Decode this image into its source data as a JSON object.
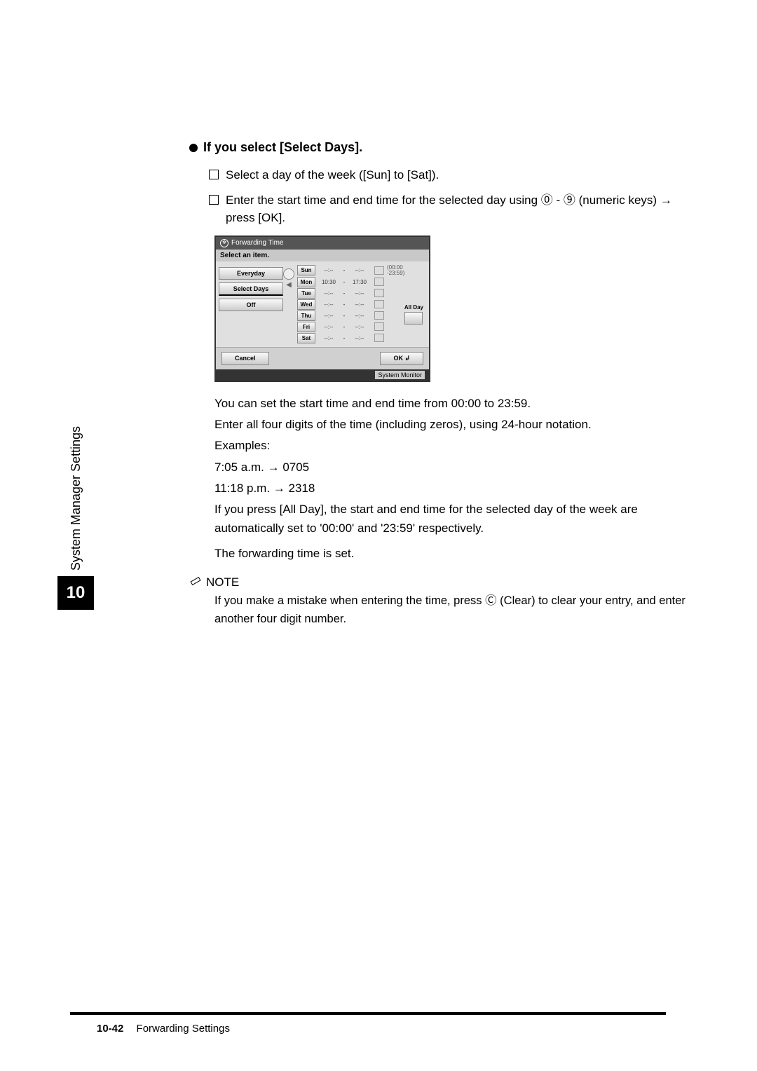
{
  "side": {
    "label": "System Manager Settings",
    "chapter": "10"
  },
  "heading": "If you select [Select Days].",
  "sub": [
    "Select a day of the week ([Sun] to [Sat]).",
    "Enter the start time and end time for the selected day using ⓪ - ⑨ (numeric keys) → press [OK]."
  ],
  "screenshot": {
    "title": "Forwarding Time",
    "subtitle": "Select an item.",
    "leftButtons": [
      "Everyday",
      "Select Days",
      "Off"
    ],
    "days": [
      "Sun",
      "Mon",
      "Tue",
      "Wed",
      "Thu",
      "Fri",
      "Sat"
    ],
    "empty": "--:--",
    "monStart": "10:30",
    "monEnd": "17:30",
    "range": "(00:00\n-23:59)",
    "allDay": "All Day",
    "cancel": "Cancel",
    "ok": "OK",
    "sysmon": "System Monitor"
  },
  "body": {
    "l1": "You can set the start time and end time from 00:00 to 23:59.",
    "l2": "Enter all four digits of the time (including zeros), using 24-hour notation.",
    "l3": "Examples:",
    "l4": "7:05 a.m. → 0705",
    "l5": "11:18 p.m. → 2318",
    "l6": "If you press [All Day], the start and end time for the selected day of the week are automatically set to '00:00' and '23:59' respectively.",
    "l7": "The forwarding time is set."
  },
  "note": {
    "head": "NOTE",
    "text": "If you make a mistake when entering the time, press Ⓒ (Clear) to clear your entry, and enter another four digit number."
  },
  "footer": {
    "page": "10-42",
    "title": "Forwarding Settings"
  }
}
